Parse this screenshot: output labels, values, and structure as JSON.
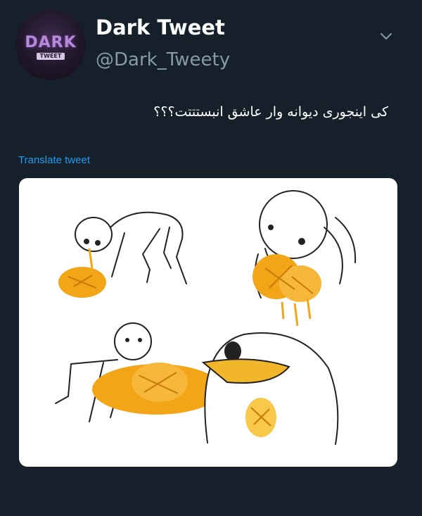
{
  "profile": {
    "display_name": "Dark Tweet",
    "handle": "@Dark_Tweety",
    "avatar_logo_text": "DARK",
    "avatar_logo_sub": "TWEET"
  },
  "tweet": {
    "text": "کی اینجوری دیوانه وار عاشق انبستتتت؟؟؟",
    "translate_label": "Translate tweet"
  },
  "icons": {
    "menu": "chevron-down-icon"
  },
  "colors": {
    "background": "#15202b",
    "primary_text": "#ffffff",
    "secondary_text": "#8899a6",
    "link": "#1d9bf0",
    "mango": "#f2a516"
  }
}
